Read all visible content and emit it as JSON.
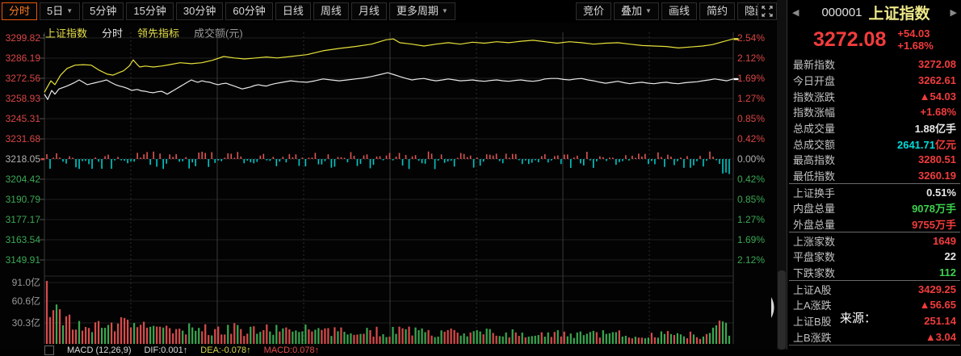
{
  "toolbar": {
    "left_buttons": [
      {
        "label": "分时",
        "active": true,
        "caret": false
      },
      {
        "label": "5日",
        "active": false,
        "caret": true
      },
      {
        "label": "5分钟",
        "active": false,
        "caret": false
      },
      {
        "label": "15分钟",
        "active": false,
        "caret": false
      },
      {
        "label": "30分钟",
        "active": false,
        "caret": false
      },
      {
        "label": "60分钟",
        "active": false,
        "caret": false
      },
      {
        "label": "日线",
        "active": false,
        "caret": false
      },
      {
        "label": "周线",
        "active": false,
        "caret": false
      },
      {
        "label": "月线",
        "active": false,
        "caret": false
      },
      {
        "label": "更多周期",
        "active": false,
        "caret": true
      }
    ],
    "right_buttons": [
      {
        "label": "竞价",
        "caret": false
      },
      {
        "label": "叠加",
        "caret": true
      },
      {
        "label": "画线",
        "caret": false
      },
      {
        "label": "简约",
        "caret": false
      },
      {
        "label": "隐藏»",
        "caret": false
      }
    ]
  },
  "legend": {
    "items": [
      {
        "label": "上证指数",
        "color": "#e6e04a"
      },
      {
        "label": "分时",
        "color": "#e0e0e0"
      },
      {
        "label": "领先指标",
        "color": "#e6e04a"
      },
      {
        "label": "成交额(元)",
        "color": "#9a9a9a"
      }
    ]
  },
  "chart_data": {
    "type": "line",
    "title": "上证指数 分时",
    "prev_close": 3218.05,
    "open": 3262.61,
    "latest": 3272.08,
    "high": 3280.51,
    "low": 3260.19,
    "y_axis_price": [
      "3299.82",
      "3286.19",
      "3272.56",
      "3258.93",
      "3245.31",
      "3231.68",
      "3218.05",
      "3204.42",
      "3190.79",
      "3177.17",
      "3163.54",
      "3149.91"
    ],
    "y_axis_pct": [
      "2.54%",
      "2.12%",
      "1.69%",
      "1.27%",
      "0.85%",
      "0.42%",
      "0.00%",
      "0.42%",
      "0.85%",
      "1.27%",
      "1.69%",
      "2.12%"
    ],
    "volume_axis": [
      "91.0亿",
      "60.6亿",
      "30.3亿"
    ],
    "series": [
      {
        "name": "领先指标",
        "color": "#e6e03a",
        "points": [
          [
            55,
            1.4
          ],
          [
            63,
            1.64
          ],
          [
            68,
            1.56
          ],
          [
            75,
            1.76
          ],
          [
            83,
            1.9
          ],
          [
            93,
            1.97
          ],
          [
            103,
            1.98
          ],
          [
            113,
            1.97
          ],
          [
            123,
            1.86
          ],
          [
            133,
            1.78
          ],
          [
            140,
            1.76
          ],
          [
            147,
            1.81
          ],
          [
            153,
            1.85
          ],
          [
            160,
            1.95
          ],
          [
            165,
            2.08
          ],
          [
            169,
            2.0
          ],
          [
            173,
            1.93
          ],
          [
            180,
            1.95
          ],
          [
            190,
            1.93
          ],
          [
            200,
            1.95
          ],
          [
            210,
            1.98
          ],
          [
            223,
            2.02
          ],
          [
            237,
            2.0
          ],
          [
            250,
            2.02
          ],
          [
            263,
            2.07
          ],
          [
            277,
            2.15
          ],
          [
            290,
            2.12
          ],
          [
            303,
            2.1
          ],
          [
            317,
            2.12
          ],
          [
            330,
            2.14
          ],
          [
            343,
            2.12
          ],
          [
            360,
            2.15
          ],
          [
            380,
            2.19
          ],
          [
            400,
            2.27
          ],
          [
            420,
            2.32
          ],
          [
            440,
            2.36
          ],
          [
            460,
            2.41
          ],
          [
            478,
            2.5
          ],
          [
            487,
            2.52
          ],
          [
            495,
            2.44
          ],
          [
            510,
            2.41
          ],
          [
            525,
            2.37
          ],
          [
            540,
            2.41
          ],
          [
            555,
            2.44
          ],
          [
            570,
            2.41
          ],
          [
            585,
            2.45
          ],
          [
            600,
            2.43
          ],
          [
            615,
            2.46
          ],
          [
            630,
            2.44
          ],
          [
            645,
            2.47
          ],
          [
            660,
            2.49
          ],
          [
            675,
            2.46
          ],
          [
            690,
            2.43
          ],
          [
            705,
            2.46
          ],
          [
            720,
            2.44
          ],
          [
            735,
            2.41
          ],
          [
            750,
            2.43
          ],
          [
            765,
            2.44
          ],
          [
            780,
            2.41
          ],
          [
            795,
            2.38
          ],
          [
            810,
            2.37
          ],
          [
            825,
            2.36
          ],
          [
            840,
            2.33
          ],
          [
            855,
            2.35
          ],
          [
            870,
            2.37
          ],
          [
            882,
            2.4
          ],
          [
            895,
            2.46
          ],
          [
            908,
            2.52
          ]
        ]
      },
      {
        "name": "分时价格",
        "color": "#e8e8e8",
        "points": [
          [
            55,
            1.36
          ],
          [
            59,
            1.25
          ],
          [
            64,
            1.44
          ],
          [
            68,
            1.36
          ],
          [
            73,
            1.47
          ],
          [
            78,
            1.5
          ],
          [
            83,
            1.53
          ],
          [
            88,
            1.57
          ],
          [
            93,
            1.61
          ],
          [
            98,
            1.66
          ],
          [
            103,
            1.61
          ],
          [
            108,
            1.56
          ],
          [
            113,
            1.58
          ],
          [
            118,
            1.6
          ],
          [
            123,
            1.62
          ],
          [
            128,
            1.64
          ],
          [
            132,
            1.66
          ],
          [
            137,
            1.61
          ],
          [
            143,
            1.56
          ],
          [
            148,
            1.53
          ],
          [
            153,
            1.51
          ],
          [
            158,
            1.48
          ],
          [
            163,
            1.44
          ],
          [
            170,
            1.46
          ],
          [
            175,
            1.43
          ],
          [
            180,
            1.42
          ],
          [
            185,
            1.4
          ],
          [
            190,
            1.39
          ],
          [
            195,
            1.41
          ],
          [
            200,
            1.42
          ],
          [
            204,
            1.39
          ],
          [
            207,
            1.36
          ],
          [
            211,
            1.4
          ],
          [
            215,
            1.44
          ],
          [
            219,
            1.48
          ],
          [
            223,
            1.52
          ],
          [
            227,
            1.56
          ],
          [
            232,
            1.61
          ],
          [
            237,
            1.66
          ],
          [
            241,
            1.63
          ],
          [
            245,
            1.61
          ],
          [
            250,
            1.64
          ],
          [
            255,
            1.62
          ],
          [
            260,
            1.61
          ],
          [
            265,
            1.58
          ],
          [
            270,
            1.56
          ],
          [
            275,
            1.58
          ],
          [
            280,
            1.59
          ],
          [
            285,
            1.56
          ],
          [
            290,
            1.53
          ],
          [
            295,
            1.5
          ],
          [
            300,
            1.47
          ],
          [
            305,
            1.49
          ],
          [
            310,
            1.51
          ],
          [
            315,
            1.54
          ],
          [
            320,
            1.56
          ],
          [
            325,
            1.54
          ],
          [
            330,
            1.53
          ],
          [
            335,
            1.56
          ],
          [
            340,
            1.58
          ],
          [
            350,
            1.61
          ],
          [
            360,
            1.64
          ],
          [
            370,
            1.62
          ],
          [
            380,
            1.61
          ],
          [
            390,
            1.64
          ],
          [
            400,
            1.68
          ],
          [
            410,
            1.66
          ],
          [
            420,
            1.64
          ],
          [
            430,
            1.66
          ],
          [
            440,
            1.68
          ],
          [
            450,
            1.7
          ],
          [
            460,
            1.73
          ],
          [
            470,
            1.77
          ],
          [
            480,
            1.81
          ],
          [
            488,
            1.77
          ],
          [
            495,
            1.73
          ],
          [
            503,
            1.69
          ],
          [
            510,
            1.66
          ],
          [
            518,
            1.68
          ],
          [
            525,
            1.69
          ],
          [
            533,
            1.66
          ],
          [
            540,
            1.64
          ],
          [
            548,
            1.66
          ],
          [
            555,
            1.68
          ],
          [
            563,
            1.66
          ],
          [
            570,
            1.64
          ],
          [
            578,
            1.65
          ],
          [
            585,
            1.66
          ],
          [
            593,
            1.64
          ],
          [
            600,
            1.63
          ],
          [
            608,
            1.65
          ],
          [
            615,
            1.66
          ],
          [
            623,
            1.64
          ],
          [
            630,
            1.63
          ],
          [
            638,
            1.65
          ],
          [
            645,
            1.66
          ],
          [
            653,
            1.64
          ],
          [
            660,
            1.63
          ],
          [
            668,
            1.65
          ],
          [
            675,
            1.68
          ],
          [
            683,
            1.69
          ],
          [
            690,
            1.69
          ],
          [
            698,
            1.67
          ],
          [
            705,
            1.66
          ],
          [
            713,
            1.68
          ],
          [
            720,
            1.69
          ],
          [
            728,
            1.66
          ],
          [
            735,
            1.64
          ],
          [
            743,
            1.61
          ],
          [
            750,
            1.59
          ],
          [
            758,
            1.61
          ],
          [
            765,
            1.63
          ],
          [
            773,
            1.6
          ],
          [
            780,
            1.58
          ],
          [
            788,
            1.6
          ],
          [
            795,
            1.61
          ],
          [
            803,
            1.59
          ],
          [
            810,
            1.58
          ],
          [
            818,
            1.6
          ],
          [
            825,
            1.61
          ],
          [
            833,
            1.59
          ],
          [
            840,
            1.58
          ],
          [
            848,
            1.6
          ],
          [
            855,
            1.61
          ],
          [
            863,
            1.62
          ],
          [
            870,
            1.64
          ],
          [
            878,
            1.66
          ],
          [
            885,
            1.68
          ],
          [
            893,
            1.66
          ],
          [
            900,
            1.64
          ],
          [
            908,
            1.68
          ]
        ]
      }
    ],
    "volume_bars": {
      "count": 212,
      "envelope": [
        [
          0,
          78
        ],
        [
          0.01,
          44
        ],
        [
          0.02,
          36
        ],
        [
          0.05,
          30
        ],
        [
          0.1,
          26
        ],
        [
          0.18,
          22
        ],
        [
          0.3,
          19
        ],
        [
          0.45,
          17
        ],
        [
          0.6,
          15
        ],
        [
          0.75,
          13
        ],
        [
          0.9,
          12
        ],
        [
          0.97,
          11
        ],
        [
          0.985,
          28
        ],
        [
          1,
          16
        ]
      ],
      "up_color": "#d94b4b",
      "down_color": "#3aa850"
    },
    "osc_bars": {
      "up_color": "#e05555",
      "down_color": "#00c8c8"
    },
    "marker_yellow_pct": 2.52,
    "marker_white_pct": 1.68
  },
  "panel": {
    "code": "000001",
    "name": "上证指数",
    "price": "3272.08",
    "change": "+54.03",
    "change_pct": "+1.68%",
    "rows": [
      {
        "label": "最新指数",
        "value": "3272.08",
        "color": "red",
        "sep": false
      },
      {
        "label": "今日开盘",
        "value": "3262.61",
        "color": "red",
        "sep": false
      },
      {
        "label": "指数涨跌",
        "value": "▲54.03",
        "color": "red",
        "sep": false
      },
      {
        "label": "指数涨幅",
        "value": "+1.68%",
        "color": "red",
        "sep": false
      },
      {
        "label": "总成交量",
        "value": "1.88亿手",
        "color": "white",
        "sep": false
      },
      {
        "label": "总成交额",
        "value": "2641.71",
        "unit": "亿元",
        "color": "cyan",
        "unit_color": "red",
        "sep": false
      },
      {
        "label": "最高指数",
        "value": "3280.51",
        "color": "red",
        "sep": false
      },
      {
        "label": "最低指数",
        "value": "3260.19",
        "color": "red",
        "sep": false
      },
      {
        "label": "上证换手",
        "value": "0.51%",
        "color": "white",
        "sep": true
      },
      {
        "label": "内盘总量",
        "value": "9078万手",
        "color": "green",
        "sep": false
      },
      {
        "label": "外盘总量",
        "value": "9755万手",
        "color": "red",
        "sep": false
      },
      {
        "label": "上涨家数",
        "value": "1649",
        "color": "red",
        "sep": true
      },
      {
        "label": "平盘家数",
        "value": "22",
        "color": "white",
        "sep": false
      },
      {
        "label": "下跌家数",
        "value": "112",
        "color": "green",
        "sep": false
      },
      {
        "label": "上证A股",
        "value": "3429.25",
        "color": "red",
        "sep": true
      },
      {
        "label": "上A涨跌",
        "value": "▲56.65",
        "color": "red",
        "sep": false
      },
      {
        "label": "上证B股",
        "value": "251.14",
        "color": "red",
        "sep": false
      },
      {
        "label": "上B涨跌",
        "value": "▲3.04",
        "color": "red",
        "sep": false
      }
    ]
  },
  "macd": {
    "name": "MACD",
    "params": "(12,26,9)",
    "dif": "DIF:0.001↑",
    "dea": "DEA:-0.078↑",
    "macd": "MACD:0.078↑"
  },
  "watermark": "来源：",
  "colors": {
    "red": "#f23c3c",
    "green": "#3cd04e",
    "cyan": "#00dcdc",
    "white": "#e8e8e8",
    "axis_red": "#d94545",
    "axis_green": "#3aa854",
    "axis_mid": "#b0b0b0"
  }
}
